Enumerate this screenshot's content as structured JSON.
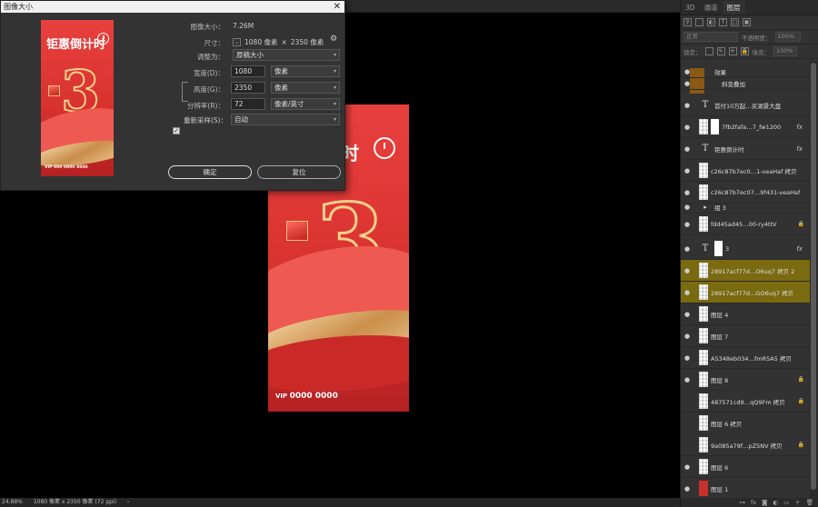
{
  "dialog": {
    "title": "图像大小",
    "close": "✕",
    "image_size_label": "图像大小：",
    "image_size_value": "7.26M",
    "dimensions_label": "尺寸：",
    "dimensions_w": "1080 像素",
    "dimensions_x": "×",
    "dimensions_h": "2350 像素",
    "fit_label": "调整为：",
    "fit_value": "原稿大小",
    "width_label": "宽度(D)：",
    "width_value": "1080",
    "width_unit": "像素",
    "height_label": "高度(G)：",
    "height_value": "2350",
    "height_unit": "像素",
    "resolution_label": "分辨率(R)：",
    "resolution_value": "72",
    "resolution_unit": "像素/英寸",
    "resample_label": "重新采样(S)：",
    "resample_value": "自动",
    "ok": "确定",
    "reset": "复位"
  },
  "poster": {
    "title": "钜惠倒计时",
    "three": "3",
    "vip_small": "VIP",
    "vip_phone": "0000 0000",
    "big_title_partial": "计时",
    "thumb_vip": "VIP 000 0000 0000"
  },
  "statusbar": {
    "zoom": "24.88%",
    "doc": "1080 像素 x 2350 像素 (72 ppi)",
    "arrow": "›"
  },
  "panel": {
    "tabs": [
      "3D",
      "通道",
      "图层"
    ],
    "blend_mode": "正常",
    "opacity_label": "不透明度：",
    "opacity_value": "100%",
    "lock_label": "锁定：",
    "fill_label": "填充：",
    "fill_value": "100%",
    "layers": [
      {
        "name": "效果",
        "kind": "effect",
        "eye": "●",
        "fx": "",
        "lock": ""
      },
      {
        "name": "斜变叠加",
        "kind": "effect2",
        "eye": "●",
        "fx": "",
        "lock": ""
      },
      {
        "name": "首付10万起…买湖景大盘",
        "kind": "text",
        "eye": "●",
        "fx": "",
        "lock": ""
      },
      {
        "name": "7fb2fafa…7_fw1200",
        "kind": "mask",
        "eye": "●",
        "fx": "fx",
        "lock": ""
      },
      {
        "name": "钜惠倒计时",
        "kind": "text",
        "eye": "●",
        "fx": "fx",
        "lock": ""
      },
      {
        "name": "c26c87b7ec0…1-veaHaf 拷贝",
        "kind": "img",
        "eye": "●",
        "fx": "",
        "lock": ""
      },
      {
        "name": "c26c87b7ec07…9f431-veaHaf",
        "kind": "img",
        "eye": "●",
        "fx": "",
        "lock": ""
      },
      {
        "name": "组 3",
        "kind": "group",
        "eye": "●",
        "fx": "",
        "lock": ""
      },
      {
        "name": "fdd45ad45…00-ry4ttV",
        "kind": "img",
        "eye": "●",
        "fx": "",
        "lock": "🔒"
      },
      {
        "name": "3",
        "kind": "text3",
        "eye": "●",
        "fx": "fx",
        "lock": ""
      },
      {
        "name": "28917acf77d…O6uq7 拷贝 2",
        "kind": "img",
        "eye": "●",
        "fx": "",
        "lock": ""
      },
      {
        "name": "28917acf77d…GO6uq7 拷贝",
        "kind": "img",
        "eye": "●",
        "fx": "",
        "lock": ""
      },
      {
        "name": "图层 4",
        "kind": "img",
        "eye": "●",
        "fx": "",
        "lock": ""
      },
      {
        "name": "图层 7",
        "kind": "img",
        "eye": "●",
        "fx": "",
        "lock": ""
      },
      {
        "name": "A5348eb034…fmR5A5 拷贝",
        "kind": "img",
        "eye": "●",
        "fx": "",
        "lock": ""
      },
      {
        "name": "图层 8",
        "kind": "img",
        "eye": "●",
        "fx": "",
        "lock": "🔒"
      },
      {
        "name": "487571cd9…qQ9Fm 拷贝",
        "kind": "img",
        "eye": "",
        "fx": "",
        "lock": "🔒"
      },
      {
        "name": "图层 6 拷贝",
        "kind": "img",
        "eye": "",
        "fx": "",
        "lock": ""
      },
      {
        "name": "9a085a79f…pZ5NV 拷贝",
        "kind": "img",
        "eye": "",
        "fx": "",
        "lock": "🔒"
      },
      {
        "name": "图层 6",
        "kind": "img",
        "eye": "●",
        "fx": "",
        "lock": ""
      },
      {
        "name": "图层 1",
        "kind": "red",
        "eye": "●",
        "fx": "",
        "lock": ""
      }
    ]
  },
  "colors": {
    "poster_red": "#d8322f",
    "gold": "#f5d08a",
    "highlight_a": "#8a5a14",
    "highlight_b": "#7a6a10"
  }
}
